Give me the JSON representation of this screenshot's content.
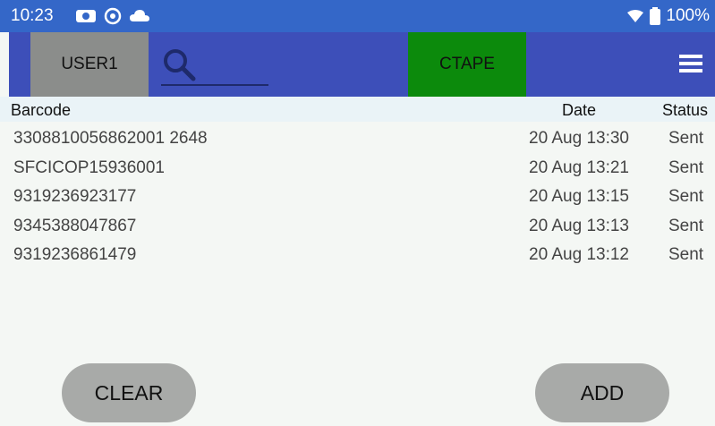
{
  "statusbar": {
    "time": "10:23",
    "battery": "100%",
    "icons_left": [
      "camera-icon",
      "settings-circle-icon",
      "cloud-icon"
    ],
    "icons_right": [
      "wifi-icon",
      "battery-icon"
    ]
  },
  "toolbar": {
    "user_label": "USER1",
    "ctape_label": "CTAPE",
    "search_placeholder": "",
    "colors": {
      "toolbar_bg": "#3d4fb9",
      "user_bg": "#8b8d8b",
      "ctape_bg": "#0c8a0c"
    }
  },
  "table": {
    "headers": {
      "barcode": "Barcode",
      "date": "Date",
      "status": "Status"
    },
    "rows": [
      {
        "barcode": "3308810056862001 2648",
        "date": "20 Aug 13:30",
        "status": "Sent"
      },
      {
        "barcode": "SFCICOP15936001",
        "date": "20 Aug 13:21",
        "status": "Sent"
      },
      {
        "barcode": "9319236923177",
        "date": "20 Aug 13:15",
        "status": "Sent"
      },
      {
        "barcode": "9345388047867",
        "date": "20 Aug 13:13",
        "status": "Sent"
      },
      {
        "barcode": "9319236861479",
        "date": "20 Aug 13:12",
        "status": "Sent"
      }
    ]
  },
  "buttons": {
    "clear": "CLEAR",
    "add": "ADD"
  }
}
